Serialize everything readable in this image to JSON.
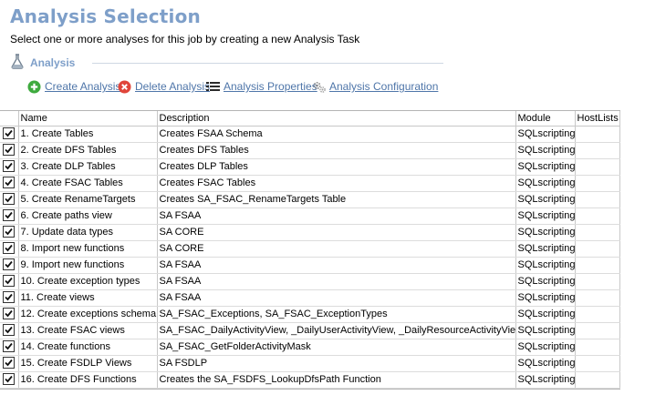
{
  "header": {
    "title": "Analysis Selection",
    "subtitle": "Select one or more analyses for this job by creating a new Analysis Task"
  },
  "section": {
    "label": "Analysis",
    "icon": "flask-icon"
  },
  "toolbar": {
    "create": "Create Analysis",
    "delete": "Delete Analysis",
    "properties": "Analysis Properties",
    "configuration": "Analysis Configuration"
  },
  "grid": {
    "columns": [
      "Name",
      "Description",
      "Module",
      "HostLists"
    ],
    "rows": [
      {
        "checked": true,
        "name": "1. Create Tables",
        "description": "Creates FSAA Schema",
        "module": "SQLscripting",
        "hostlists": ""
      },
      {
        "checked": true,
        "name": "2. Create DFS Tables",
        "description": "Creates DFS Tables",
        "module": "SQLscripting",
        "hostlists": ""
      },
      {
        "checked": true,
        "name": "3. Create DLP Tables",
        "description": "Creates DLP Tables",
        "module": "SQLscripting",
        "hostlists": ""
      },
      {
        "checked": true,
        "name": "4. Create FSAC Tables",
        "description": "Creates FSAC Tables",
        "module": "SQLscripting",
        "hostlists": ""
      },
      {
        "checked": true,
        "name": "5. Create RenameTargets",
        "description": "Creates SA_FSAC_RenameTargets Table",
        "module": "SQLscripting",
        "hostlists": ""
      },
      {
        "checked": true,
        "name": "6. Create paths view",
        "description": "SA FSAA",
        "module": "SQLscripting",
        "hostlists": ""
      },
      {
        "checked": true,
        "name": "7. Update data types",
        "description": "SA CORE",
        "module": "SQLscripting",
        "hostlists": ""
      },
      {
        "checked": true,
        "name": "8. Import new functions",
        "description": "SA CORE",
        "module": "SQLscripting",
        "hostlists": ""
      },
      {
        "checked": true,
        "name": "9. Import new functions",
        "description": "SA FSAA",
        "module": "SQLscripting",
        "hostlists": ""
      },
      {
        "checked": true,
        "name": "10. Create exception types",
        "description": "SA FSAA",
        "module": "SQLscripting",
        "hostlists": ""
      },
      {
        "checked": true,
        "name": "11. Create views",
        "description": "SA FSAA",
        "module": "SQLscripting",
        "hostlists": ""
      },
      {
        "checked": true,
        "name": "12. Create exceptions schema",
        "description": "SA_FSAC_Exceptions, SA_FSAC_ExceptionTypes",
        "module": "SQLscripting",
        "hostlists": ""
      },
      {
        "checked": true,
        "name": "13. Create FSAC views",
        "description": "SA_FSAC_DailyActivityView, _DailyUserActivityView, _DailyResourceActivityView",
        "module": "SQLscripting",
        "hostlists": ""
      },
      {
        "checked": true,
        "name": "14. Create functions",
        "description": "SA_FSAC_GetFolderActivityMask",
        "module": "SQLscripting",
        "hostlists": ""
      },
      {
        "checked": true,
        "name": "15. Create FSDLP Views",
        "description": "SA FSDLP",
        "module": "SQLscripting",
        "hostlists": ""
      },
      {
        "checked": true,
        "name": "16. Create DFS  Functions",
        "description": "Creates the SA_FSDFS_LookupDfsPath Function",
        "module": "SQLscripting",
        "hostlists": ""
      }
    ]
  },
  "colors": {
    "title": "#7e9fc9",
    "link": "#4f76a9",
    "create_icon": "#3eaa3e",
    "delete_icon": "#e0453a"
  }
}
